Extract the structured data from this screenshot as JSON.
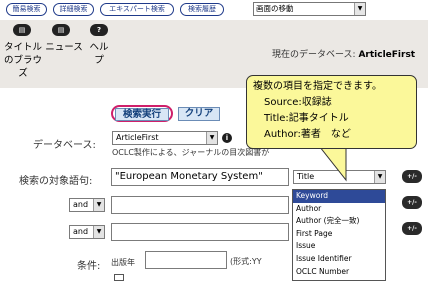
{
  "nav": {
    "buttons": [
      "簡易検索",
      "詳細検索",
      "エキスパート検索",
      "検索履歴"
    ],
    "select_value": "画面の移動"
  },
  "icons": {
    "browse_label": "タイトル\nのブラウ\nズ",
    "news_label": "ニュース",
    "help_label": "ヘルプ"
  },
  "current_db": {
    "prefix": "現在のデータベース:",
    "name": "ArticleFirst"
  },
  "actions": {
    "search_label": "検索実行",
    "clear_label": "クリア"
  },
  "database": {
    "label": "データベース:",
    "value": "ArticleFirst",
    "desc": "OCLC製作による、ジャーナルの目次図書が"
  },
  "query": {
    "label": "検索の対象語句:",
    "term1": "\"European Monetary System\"",
    "field1": "Title",
    "op2": "and",
    "op3": "and"
  },
  "conditions": {
    "label": "条件:",
    "year_label": "出版年",
    "format_hint": "(形式:YY"
  },
  "dropdown_options": [
    "Keyword",
    "Author",
    "Author (完全一致)",
    "First Page",
    "Issue",
    "Issue Identifier",
    "OCLC Number"
  ],
  "callout": {
    "line1": "複数の項目を指定できます。",
    "line2": "Source:収録誌",
    "line3": "Title:記事タイトル",
    "line4": "Author:著者　など"
  },
  "colors": {
    "nav_border": "#1f3a8a",
    "accent_pink": "#cf1f6a",
    "button_bg": "#d8e6f5",
    "highlight": "#2e4a98",
    "callout_bg": "#fbf89a"
  }
}
